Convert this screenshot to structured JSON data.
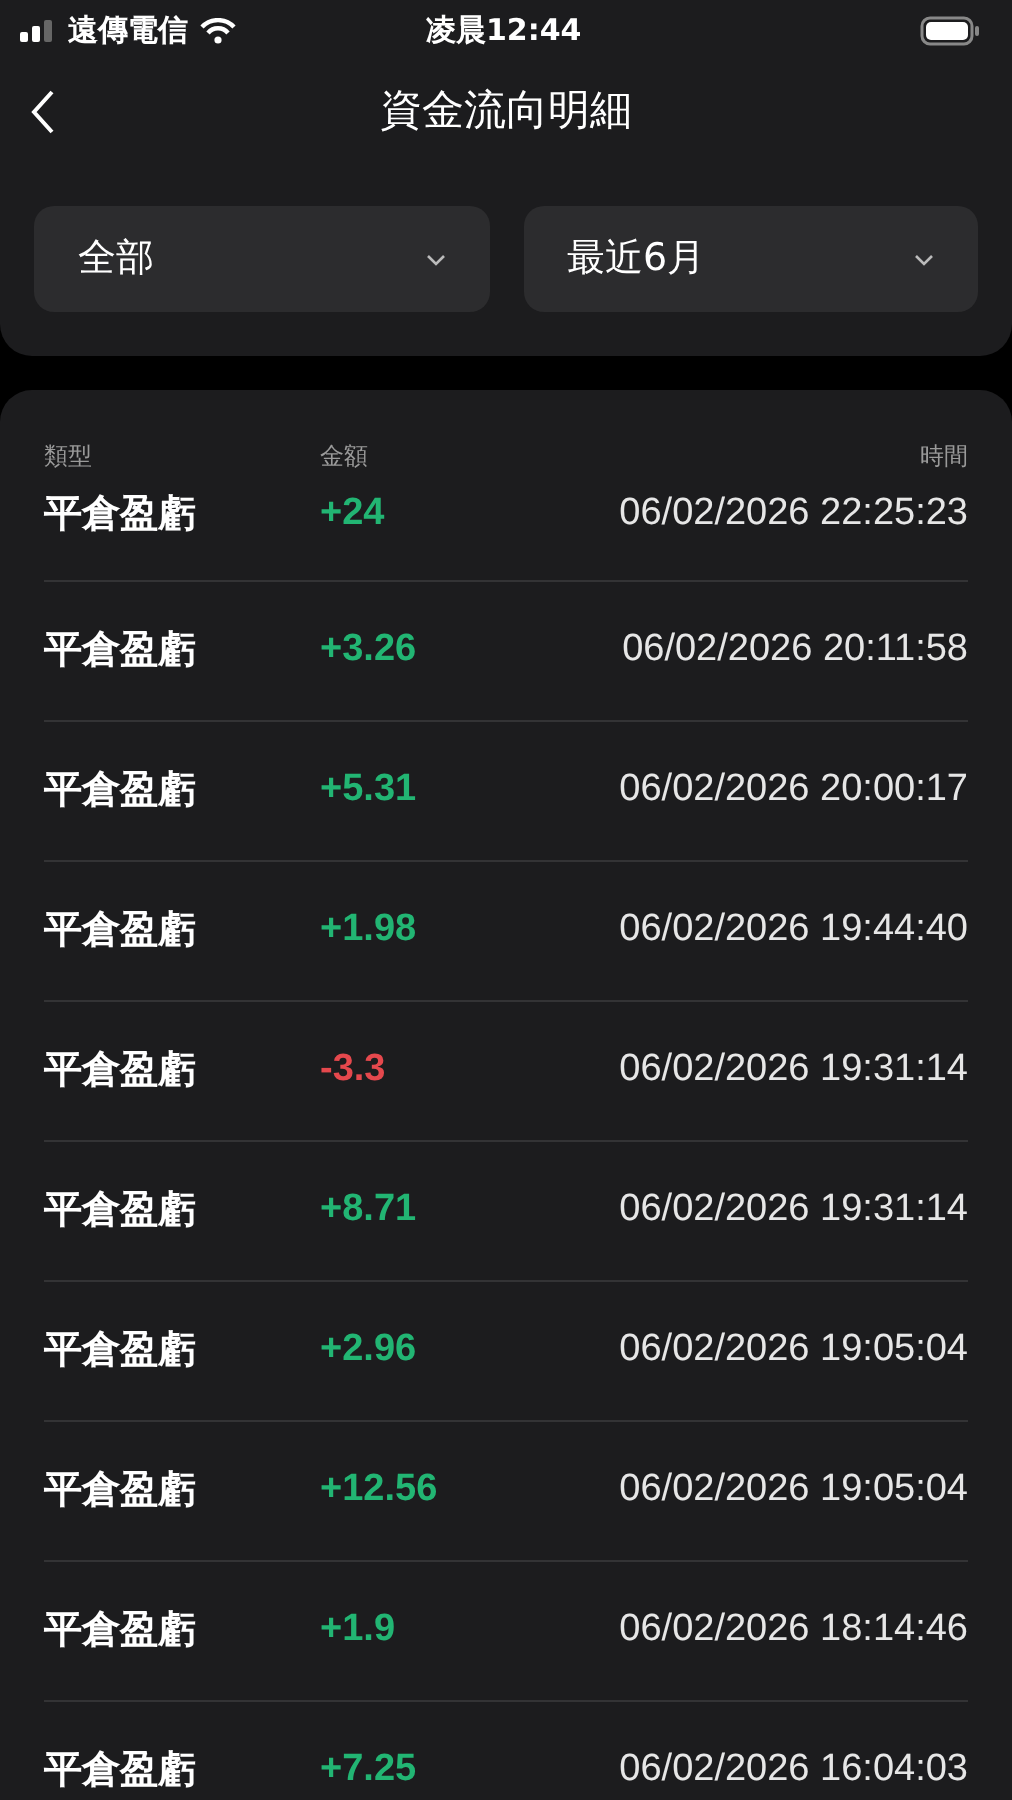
{
  "status_bar": {
    "carrier": "遠傳電信",
    "time": "凌晨12:44"
  },
  "header": {
    "title": "資金流向明細"
  },
  "filters": [
    {
      "label": "全部"
    },
    {
      "label": "最近6月"
    }
  ],
  "table": {
    "columns": [
      "類型",
      "金額",
      "時間"
    ],
    "rows": [
      {
        "type": "平倉盈虧",
        "amount": "+24",
        "color": "#22b573",
        "time": "06/02/2026 22:25:23"
      },
      {
        "type": "平倉盈虧",
        "amount": "+3.26",
        "color": "#22b573",
        "time": "06/02/2026 20:11:58"
      },
      {
        "type": "平倉盈虧",
        "amount": "+5.31",
        "color": "#22b573",
        "time": "06/02/2026 20:00:17"
      },
      {
        "type": "平倉盈虧",
        "amount": "+1.98",
        "color": "#22b573",
        "time": "06/02/2026 19:44:40"
      },
      {
        "type": "平倉盈虧",
        "amount": "-3.3",
        "color": "#e5484d",
        "time": "06/02/2026 19:31:14"
      },
      {
        "type": "平倉盈虧",
        "amount": "+8.71",
        "color": "#22b573",
        "time": "06/02/2026 19:31:14"
      },
      {
        "type": "平倉盈虧",
        "amount": "+2.96",
        "color": "#22b573",
        "time": "06/02/2026 19:05:04"
      },
      {
        "type": "平倉盈虧",
        "amount": "+12.56",
        "color": "#22b573",
        "time": "06/02/2026 19:05:04"
      },
      {
        "type": "平倉盈虧",
        "amount": "+1.9",
        "color": "#22b573",
        "time": "06/02/2026 18:14:46"
      },
      {
        "type": "平倉盈虧",
        "amount": "+7.25",
        "color": "#22b573",
        "time": "06/02/2026 16:04:03"
      }
    ]
  }
}
